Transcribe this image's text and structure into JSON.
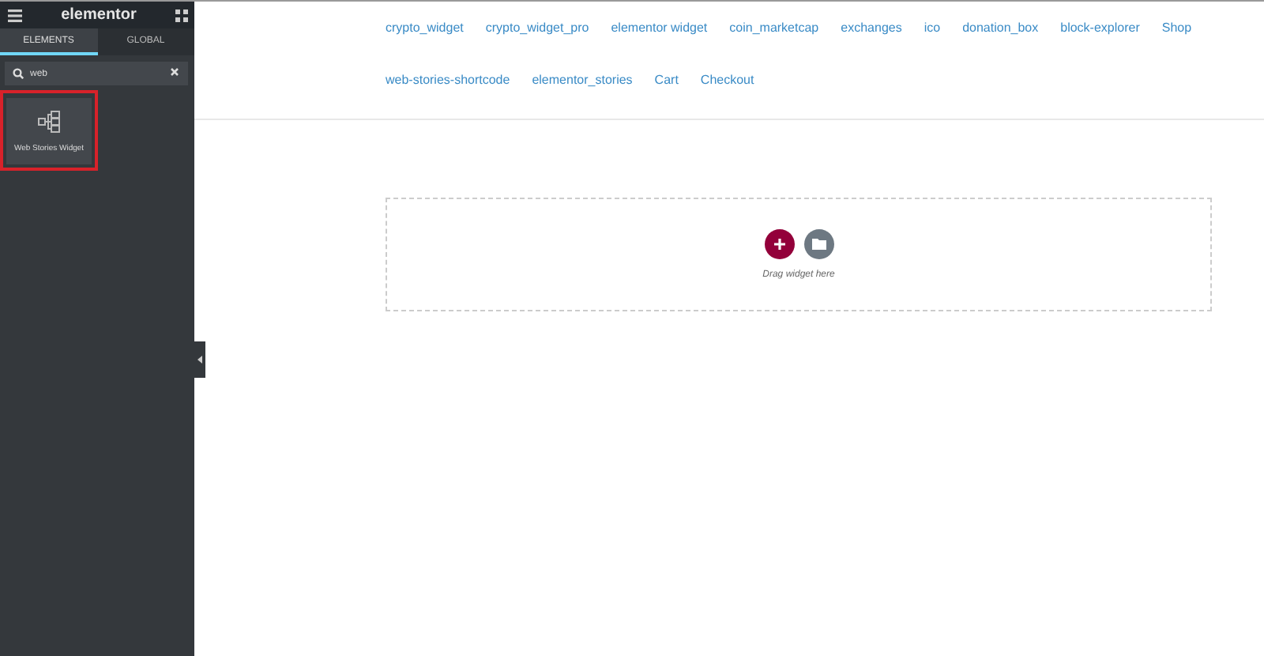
{
  "sidebar": {
    "logo": "elementor",
    "tabs": [
      {
        "label": "ELEMENTS",
        "selected": true
      },
      {
        "label": "GLOBAL",
        "selected": false
      }
    ],
    "search": {
      "value": "web"
    },
    "widgets": [
      {
        "label": "Web Stories Widget",
        "highlighted": true
      }
    ]
  },
  "menu": [
    [
      "crypto_widget",
      "crypto_widget_pro",
      "elementor widget",
      "coin_marketcap",
      "exchanges",
      "ico",
      "donation_box",
      "block-explorer",
      "Shop"
    ],
    [
      "web-stories-shortcode",
      "elementor_stories",
      "Cart",
      "Checkout"
    ]
  ],
  "dropzone": {
    "hint": "Drag widget here"
  }
}
